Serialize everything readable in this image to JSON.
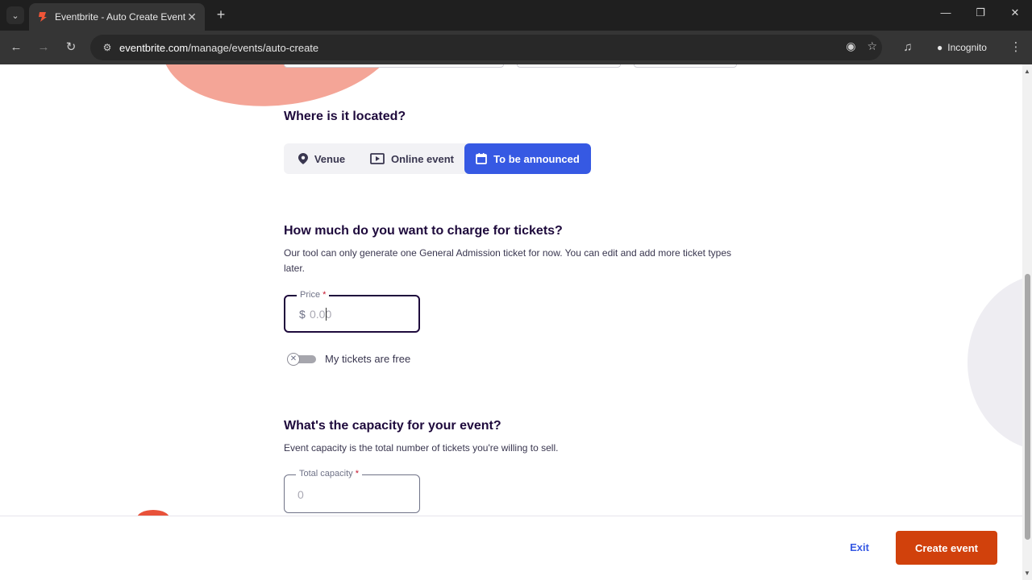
{
  "browser": {
    "tab_title": "Eventbrite - Auto Create Event",
    "url_host": "eventbrite.com",
    "url_path": "/manage/events/auto-create",
    "profile_label": "Incognito",
    "icons": {
      "tab_list": "chevron-down-icon",
      "close_tab": "close-icon",
      "new_tab": "plus-icon",
      "back": "arrow-left-icon",
      "forward": "arrow-right-icon",
      "reload": "reload-icon",
      "site_info": "tune-icon",
      "eye_off": "eye-off-icon",
      "bookmark": "star-icon",
      "media": "media-icon",
      "incognito": "incognito-icon",
      "menu": "kebab-icon"
    }
  },
  "location": {
    "heading": "Where is it located?",
    "options": [
      {
        "label": "Venue",
        "icon": "pin-icon",
        "selected": false
      },
      {
        "label": "Online event",
        "icon": "video-icon",
        "selected": false
      },
      {
        "label": "To be announced",
        "icon": "calendar-icon",
        "selected": true
      }
    ]
  },
  "tickets": {
    "heading": "How much do you want to charge for tickets?",
    "description": "Our tool can only generate one General Admission ticket for now. You can edit and add more ticket types later.",
    "price_label": "Price",
    "required_mark": "*",
    "currency": "$",
    "price_placeholder": "0.00",
    "price_value": "",
    "free_toggle_label": "My tickets are free",
    "free_toggle_on": false
  },
  "capacity": {
    "heading": "What's the capacity for your event?",
    "description": "Event capacity is the total number of tickets you're willing to sell.",
    "label": "Total capacity",
    "required_mark": "*",
    "placeholder": "0"
  },
  "footer": {
    "exit_label": "Exit",
    "create_label": "Create event"
  },
  "colors": {
    "primary_blue": "#3659e3",
    "create_orange": "#d1410c",
    "text_dark": "#1e0a3c"
  }
}
